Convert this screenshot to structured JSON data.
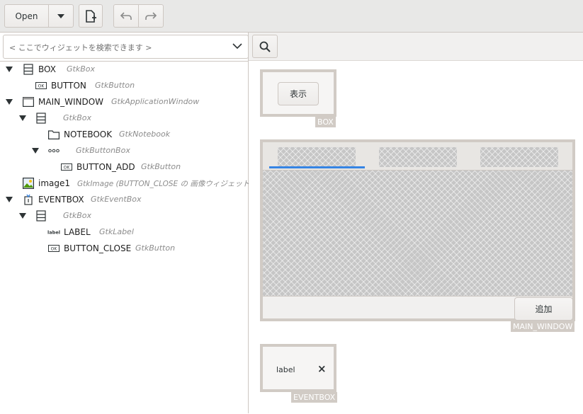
{
  "toolbar": {
    "open_label": "Open"
  },
  "search": {
    "placeholder": "< ここでウィジェットを検索できます >"
  },
  "tree": [
    {
      "name": "BOX",
      "type": "GtkBox",
      "icon": "box-icon",
      "expander": true
    },
    {
      "name": "BUTTON",
      "type": "GtkButton",
      "icon": "button-icon",
      "expander": false
    },
    {
      "name": "MAIN_WINDOW",
      "type": "GtkApplicationWindow",
      "icon": "window-icon",
      "expander": true
    },
    {
      "name": "",
      "type": "GtkBox",
      "icon": "box-icon",
      "expander": true
    },
    {
      "name": "NOTEBOOK",
      "type": "GtkNotebook",
      "icon": "notebook-icon",
      "expander": false
    },
    {
      "name": "",
      "type": "GtkButtonBox",
      "icon": "buttonbox-icon",
      "expander": true
    },
    {
      "name": "BUTTON_ADD",
      "type": "GtkButton",
      "icon": "button-icon",
      "expander": false
    },
    {
      "name": "image1",
      "type": "GtkImage  (BUTTON_CLOSE の 画像ウィジェット)",
      "icon": "image-icon",
      "expander": false
    },
    {
      "name": "EVENTBOX",
      "type": "GtkEventBox",
      "icon": "eventbox-icon",
      "expander": true
    },
    {
      "name": "",
      "type": "GtkBox",
      "icon": "box-icon",
      "expander": true
    },
    {
      "name": "LABEL",
      "type": "GtkLabel",
      "icon": "label-icon",
      "expander": false
    },
    {
      "name": "BUTTON_CLOSE",
      "type": "GtkButton",
      "icon": "button-icon",
      "expander": false
    }
  ],
  "canvas": {
    "box_tag": "BOX",
    "show_button": "表示",
    "main_window_tag": "MAIN_WINDOW",
    "add_button": "追加",
    "eventbox_tag": "EVENTBOX",
    "label_text": "label",
    "close_glyph": "×"
  },
  "colors": {
    "accent": "#3584e4",
    "frame": "#d1cbc5"
  }
}
